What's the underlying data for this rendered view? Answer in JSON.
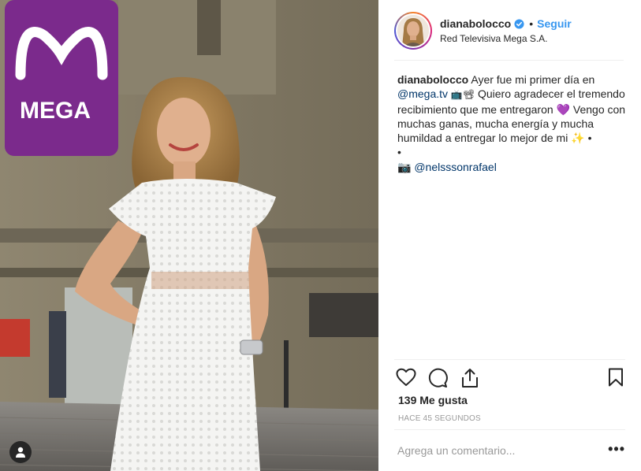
{
  "photo": {
    "sign_text": "MEGA",
    "alt": "Foto de la publicación"
  },
  "header": {
    "username": "dianabolocco",
    "dot": "•",
    "follow_label": "Seguir",
    "location": "Red Televisiva Mega S.A."
  },
  "caption": {
    "username": "dianabolocco",
    "line1": "Ayer fue mi primer día en",
    "mention1": "@mega.tv",
    "emoji1": "📺📽",
    "line2": "Quiero agradecer el tremendo recibimiento que me entregaron",
    "emoji_heart": "💜",
    "line3": "Vengo con muchas ganas, mucha energía y mucha humildad a entregar lo mejor de mi",
    "emoji_sparkle": "✨",
    "bullet1": "•",
    "bullet2": "•",
    "camera_glyph": "📷",
    "mention2": "@nelsssonrafael"
  },
  "stats": {
    "likes": "139 Me gusta",
    "time": "HACE 45 SEGUNDOS"
  },
  "comment": {
    "placeholder": "Agrega un comentario...",
    "more_label": "•••"
  },
  "colors": {
    "accent": "#3897f0",
    "mention": "#003569",
    "brand_purple": "#7b2a8c"
  }
}
